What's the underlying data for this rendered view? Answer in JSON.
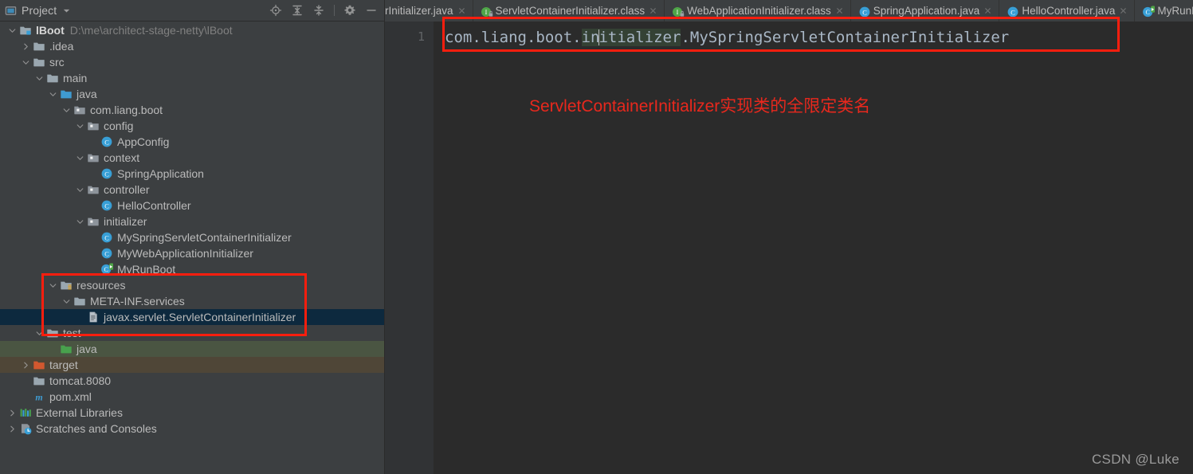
{
  "panel": {
    "title": "Project",
    "icons": [
      "project-view-icon",
      "chevron-down-icon",
      "locate-icon",
      "expand-all-icon",
      "collapse-all-icon",
      "settings-gear-icon",
      "minimize-icon"
    ]
  },
  "tree": [
    {
      "depth": 0,
      "arrow": "down",
      "icon": "module-icon",
      "label": "lBoot",
      "bold": true,
      "sub": "D:\\me\\architect-stage-netty\\lBoot",
      "state": "normal"
    },
    {
      "depth": 1,
      "arrow": "right",
      "icon": "folder-icon",
      "label": ".idea",
      "state": "normal"
    },
    {
      "depth": 1,
      "arrow": "down",
      "icon": "folder-icon",
      "label": "src",
      "state": "normal"
    },
    {
      "depth": 2,
      "arrow": "down",
      "icon": "folder-icon",
      "label": "main",
      "state": "normal"
    },
    {
      "depth": 3,
      "arrow": "down",
      "icon": "source-root-icon",
      "label": "java",
      "state": "normal"
    },
    {
      "depth": 4,
      "arrow": "down",
      "icon": "package-icon",
      "label": "com.liang.boot",
      "state": "normal"
    },
    {
      "depth": 5,
      "arrow": "down",
      "icon": "package-icon",
      "label": "config",
      "state": "normal"
    },
    {
      "depth": 6,
      "arrow": "none",
      "icon": "class-icon",
      "label": "AppConfig",
      "state": "normal"
    },
    {
      "depth": 5,
      "arrow": "down",
      "icon": "package-icon",
      "label": "context",
      "state": "normal"
    },
    {
      "depth": 6,
      "arrow": "none",
      "icon": "class-icon",
      "label": "SpringApplication",
      "state": "normal"
    },
    {
      "depth": 5,
      "arrow": "down",
      "icon": "package-icon",
      "label": "controller",
      "state": "normal"
    },
    {
      "depth": 6,
      "arrow": "none",
      "icon": "class-icon",
      "label": "HelloController",
      "state": "normal"
    },
    {
      "depth": 5,
      "arrow": "down",
      "icon": "package-icon",
      "label": "initializer",
      "state": "normal"
    },
    {
      "depth": 6,
      "arrow": "none",
      "icon": "class-icon",
      "label": "MySpringServletContainerInitializer",
      "state": "normal"
    },
    {
      "depth": 6,
      "arrow": "none",
      "icon": "class-icon",
      "label": "MyWebApplicationInitializer",
      "state": "normal"
    },
    {
      "depth": 6,
      "arrow": "none",
      "icon": "runnable-class-icon",
      "label": "MyRunBoot",
      "state": "clipped"
    },
    {
      "depth": 3,
      "arrow": "down",
      "icon": "resource-root-icon",
      "label": "resources",
      "state": "normal"
    },
    {
      "depth": 4,
      "arrow": "down",
      "icon": "folder-icon",
      "label": "META-INF.services",
      "state": "normal"
    },
    {
      "depth": 5,
      "arrow": "none",
      "icon": "file-text-icon",
      "label": "javax.servlet.ServletContainerInitializer",
      "state": "selected"
    },
    {
      "depth": 2,
      "arrow": "down",
      "icon": "folder-icon",
      "label": "test",
      "state": "clipped"
    },
    {
      "depth": 3,
      "arrow": "none",
      "icon": "test-source-root-icon",
      "label": "java",
      "state": "testroot"
    },
    {
      "depth": 1,
      "arrow": "right",
      "icon": "excluded-folder-icon",
      "label": "target",
      "state": "targetroot"
    },
    {
      "depth": 1,
      "arrow": "none",
      "icon": "folder-icon",
      "label": "tomcat.8080",
      "state": "normal"
    },
    {
      "depth": 1,
      "arrow": "none",
      "icon": "maven-icon",
      "label": "pom.xml",
      "state": "normal"
    },
    {
      "depth": 0,
      "arrow": "right",
      "icon": "libraries-icon",
      "label": "External Libraries",
      "state": "normal"
    },
    {
      "depth": 0,
      "arrow": "right",
      "icon": "scratches-icon",
      "label": "Scratches and Consoles",
      "state": "normal"
    }
  ],
  "tabs": [
    {
      "label": "rInitializer.java",
      "icon": "",
      "clipped": true,
      "active": false,
      "closable": true
    },
    {
      "label": "ServletContainerInitializer.class",
      "icon": "class-locked-icon",
      "clipped": false,
      "active": false,
      "closable": true
    },
    {
      "label": "WebApplicationInitializer.class",
      "icon": "class-locked-icon",
      "clipped": false,
      "active": false,
      "closable": true
    },
    {
      "label": "SpringApplication.java",
      "icon": "class-icon",
      "clipped": false,
      "active": false,
      "closable": true
    },
    {
      "label": "HelloController.java",
      "icon": "class-icon",
      "clipped": false,
      "active": false,
      "closable": true
    },
    {
      "label": "MyRunB",
      "icon": "runnable-class-icon",
      "clipped": false,
      "active": false,
      "closable": false
    }
  ],
  "editor": {
    "line_number": "1",
    "code_prefix": "com.liang.boot.",
    "code_ident_before_caret": "in",
    "code_ident_after_caret": "itializer",
    "code_suffix": ".MySpringServletContainerInitializer",
    "full_line": "com.liang.boot.initializer.MySpringServletContainerInitializer",
    "annotation": "ServletContainerInitializer实现类的全限定类名",
    "watermark": "CSDN @Luke"
  },
  "colors": {
    "panel_bg": "#3c3f41",
    "editor_bg": "#2b2b2b",
    "gutter_bg": "#313335",
    "selection": "#0d293e",
    "test_root": "#4a5542",
    "target_root": "#4f4637",
    "annotation_red": "#e8281d",
    "box_red": "#fa1e0e",
    "code_text": "#a9b7c6",
    "ident_highlight": "#344134",
    "tab_active": "#4e5254"
  }
}
